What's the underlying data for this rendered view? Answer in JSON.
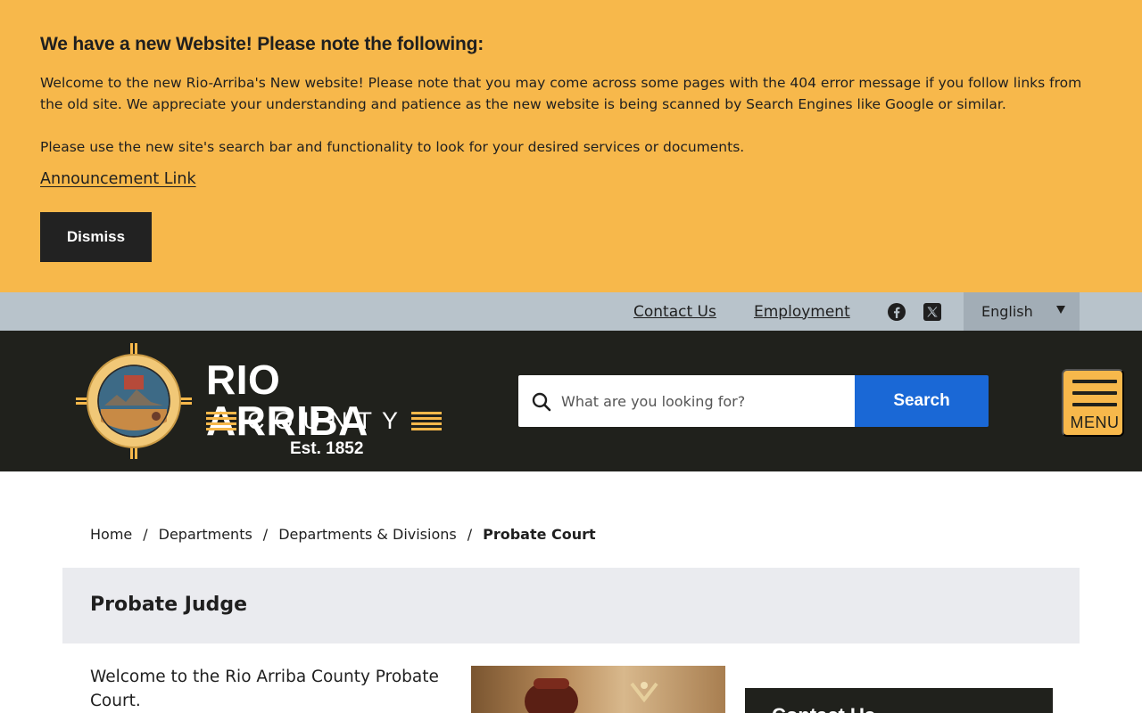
{
  "announcement": {
    "title": "We have a new Website! Please note the following:",
    "body": "Welcome to the new Rio-Arriba's New website! Please note that you may come across some pages with the 404 error message if you follow links from the old site. We appreciate your understanding and patience as the new website is being scanned by Search Engines like Google or similar.",
    "body2": "Please use the new site's search bar and functionality to look for your desired services or documents.",
    "link_label": "Announcement Link",
    "dismiss_label": "Dismiss"
  },
  "utility_nav": {
    "links": [
      "Contact Us",
      "Employment"
    ],
    "social": [
      "facebook-icon",
      "x-icon"
    ],
    "language": "English"
  },
  "header": {
    "brand": {
      "name": "RIO ARRIBA",
      "sub": "COUNTY",
      "est": "Est. 1852"
    },
    "search": {
      "placeholder": "What are you looking for?",
      "button_label": "Search"
    },
    "menu_label": "MENU"
  },
  "breadcrumb": {
    "items": [
      "Home",
      "Departments",
      "Departments & Divisions"
    ],
    "separator": "/",
    "current": "Probate Court"
  },
  "page": {
    "title": "Probate Judge",
    "intro": "Welcome to the Rio Arriba County Probate Court.",
    "side_panel_title": "Contact Us"
  },
  "colors": {
    "banner": "#f7b84b",
    "utility_bar": "#b8c3cb",
    "header": "#20211c",
    "search_button": "#1a68d6",
    "menu_button": "#f7b84b",
    "title_band": "#eaebef"
  }
}
